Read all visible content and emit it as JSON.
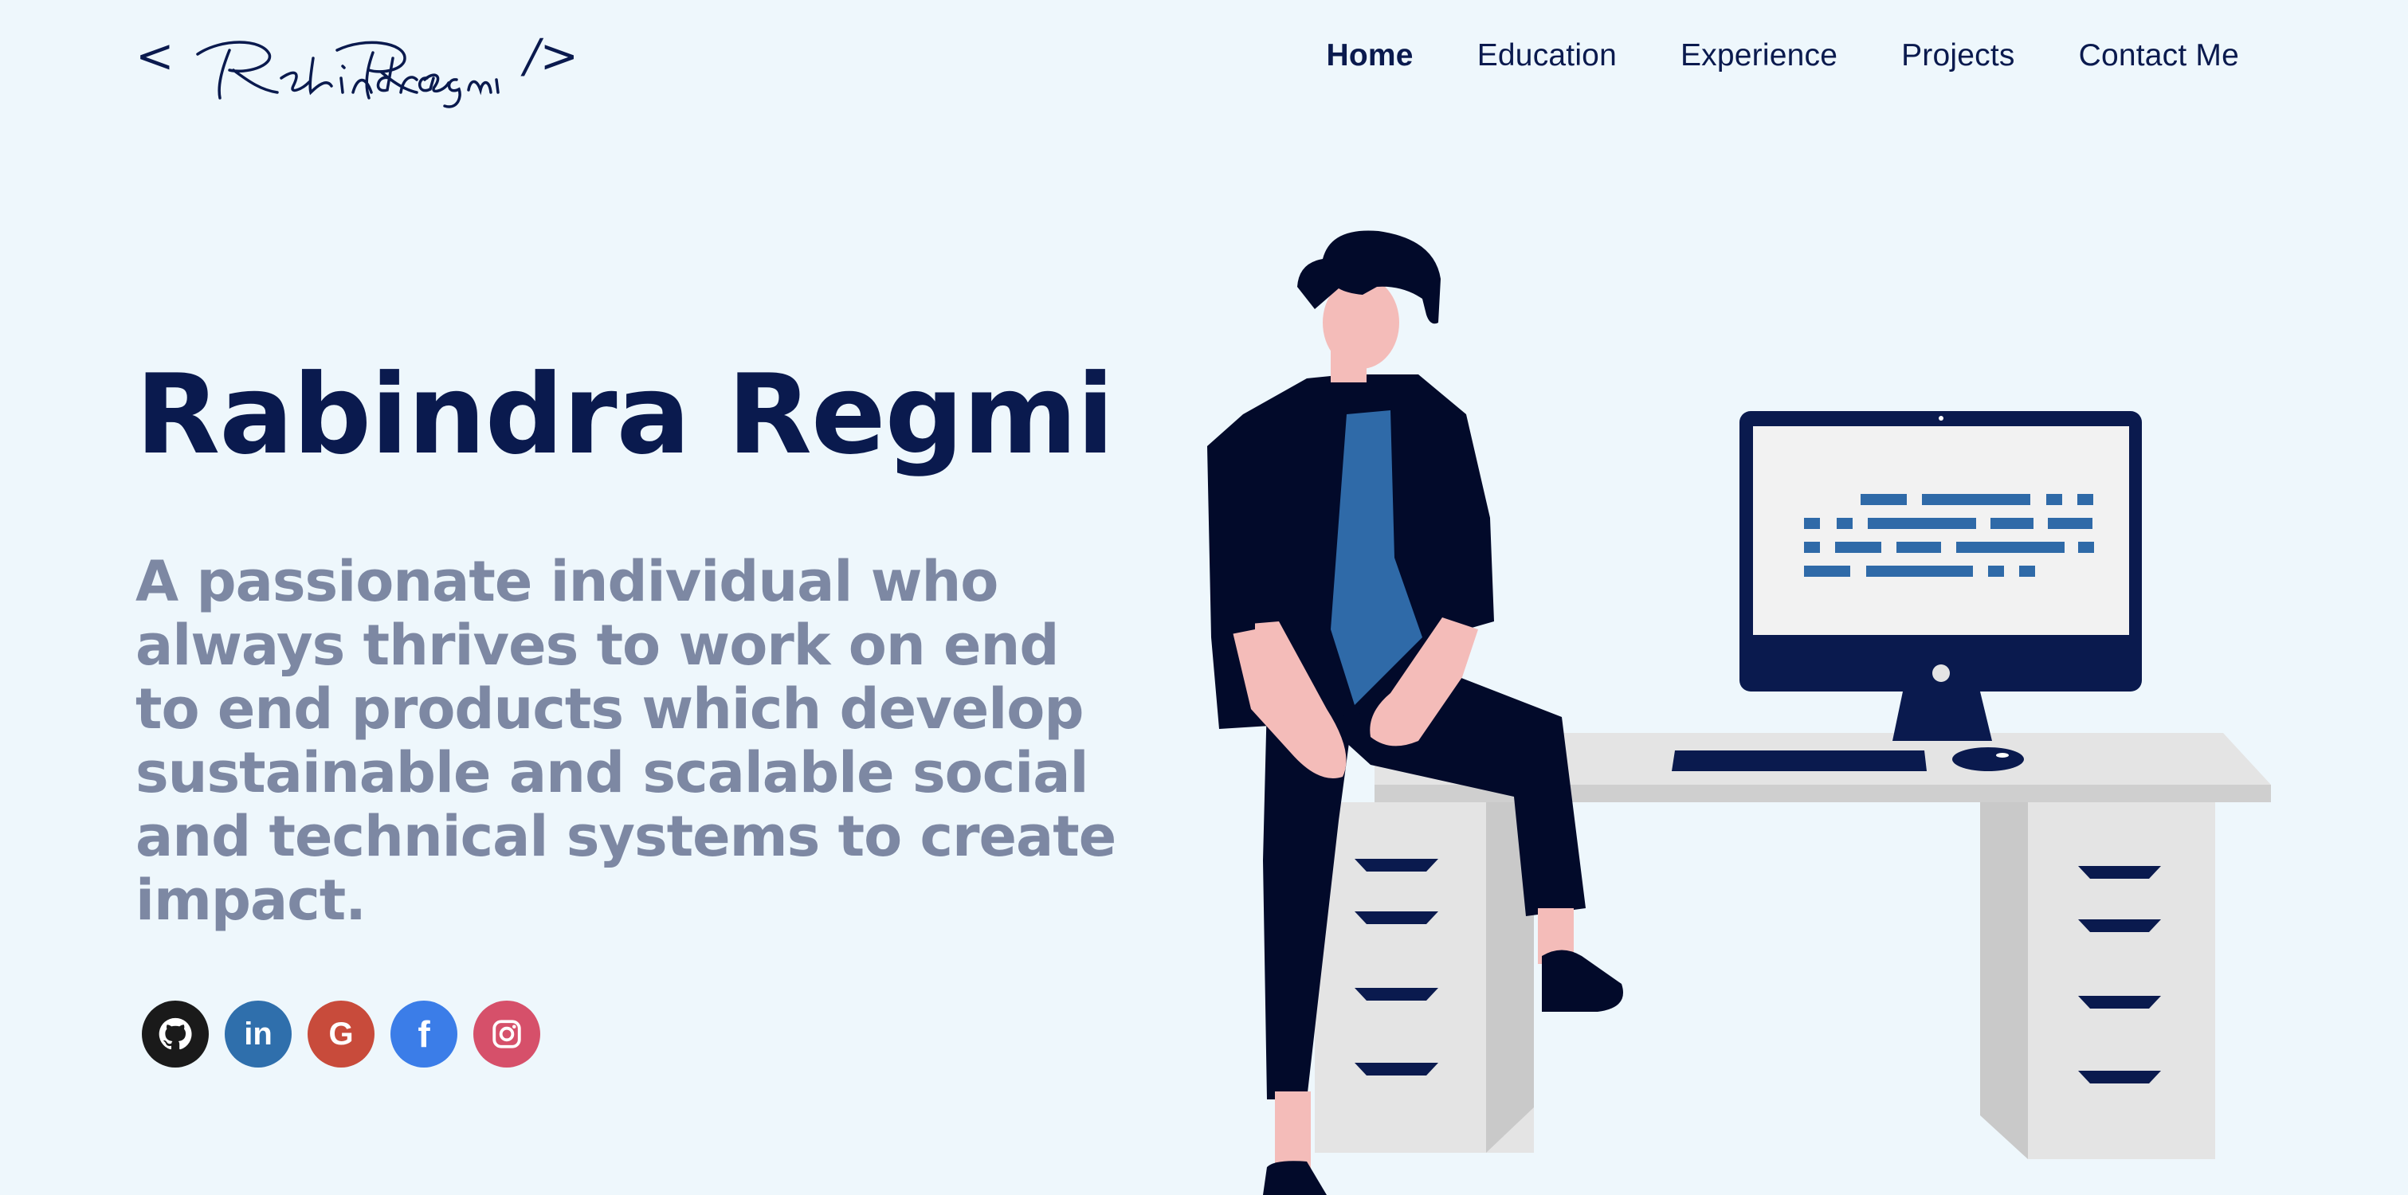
{
  "logo": {
    "open_bracket": "<",
    "signature": "Rabindra Regmi",
    "close_bracket": "/>"
  },
  "nav": [
    {
      "label": "Home",
      "active": true
    },
    {
      "label": "Education",
      "active": false
    },
    {
      "label": "Experience",
      "active": false
    },
    {
      "label": "Projects",
      "active": false
    },
    {
      "label": "Contact Me",
      "active": false
    }
  ],
  "hero": {
    "name": "Rabindra Regmi",
    "bio": "A passionate individual who always thrives to work on end to end products which develop sustainable and scalable social and technical systems to create impact."
  },
  "socials": [
    {
      "icon": "github-icon",
      "color": "#1a1a1a"
    },
    {
      "icon": "linkedin-icon",
      "color": "#2f6fac",
      "glyph": "in"
    },
    {
      "icon": "google-icon",
      "color": "#c84b3b",
      "glyph": "G"
    },
    {
      "icon": "facebook-icon",
      "color": "#3b7de8",
      "glyph": "f"
    },
    {
      "icon": "instagram-icon",
      "color": "#d6506a"
    }
  ],
  "colors": {
    "background": "#eef7fc",
    "primary": "#0a1a4e",
    "muted": "#7d88a3"
  }
}
